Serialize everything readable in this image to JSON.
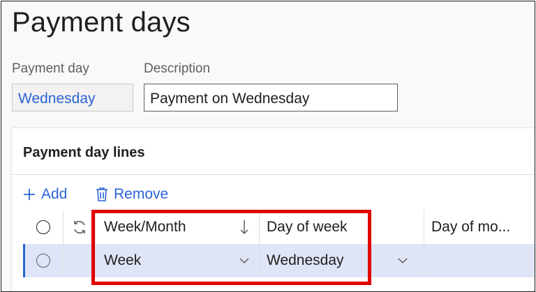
{
  "page": {
    "title": "Payment days"
  },
  "form": {
    "payment_day": {
      "label": "Payment day",
      "value": "Wednesday"
    },
    "description": {
      "label": "Description",
      "value": "Payment on Wednesday"
    }
  },
  "lines_card": {
    "title": "Payment day lines",
    "toolbar": {
      "add_label": "Add",
      "remove_label": "Remove"
    },
    "columns": {
      "week_month": "Week/Month",
      "day_of_week": "Day of week",
      "day_of_month": "Day of mo..."
    },
    "rows": [
      {
        "week_month": "Week",
        "day_of_week": "Wednesday",
        "day_of_month": ""
      }
    ]
  },
  "colors": {
    "accent": "#2b63d6",
    "selected_row": "#dfe5f7",
    "highlight_box": "#e00000"
  },
  "icons": [
    "add-icon",
    "delete-icon",
    "refresh-icon",
    "sort-descending-icon",
    "chevron-down-icon"
  ]
}
